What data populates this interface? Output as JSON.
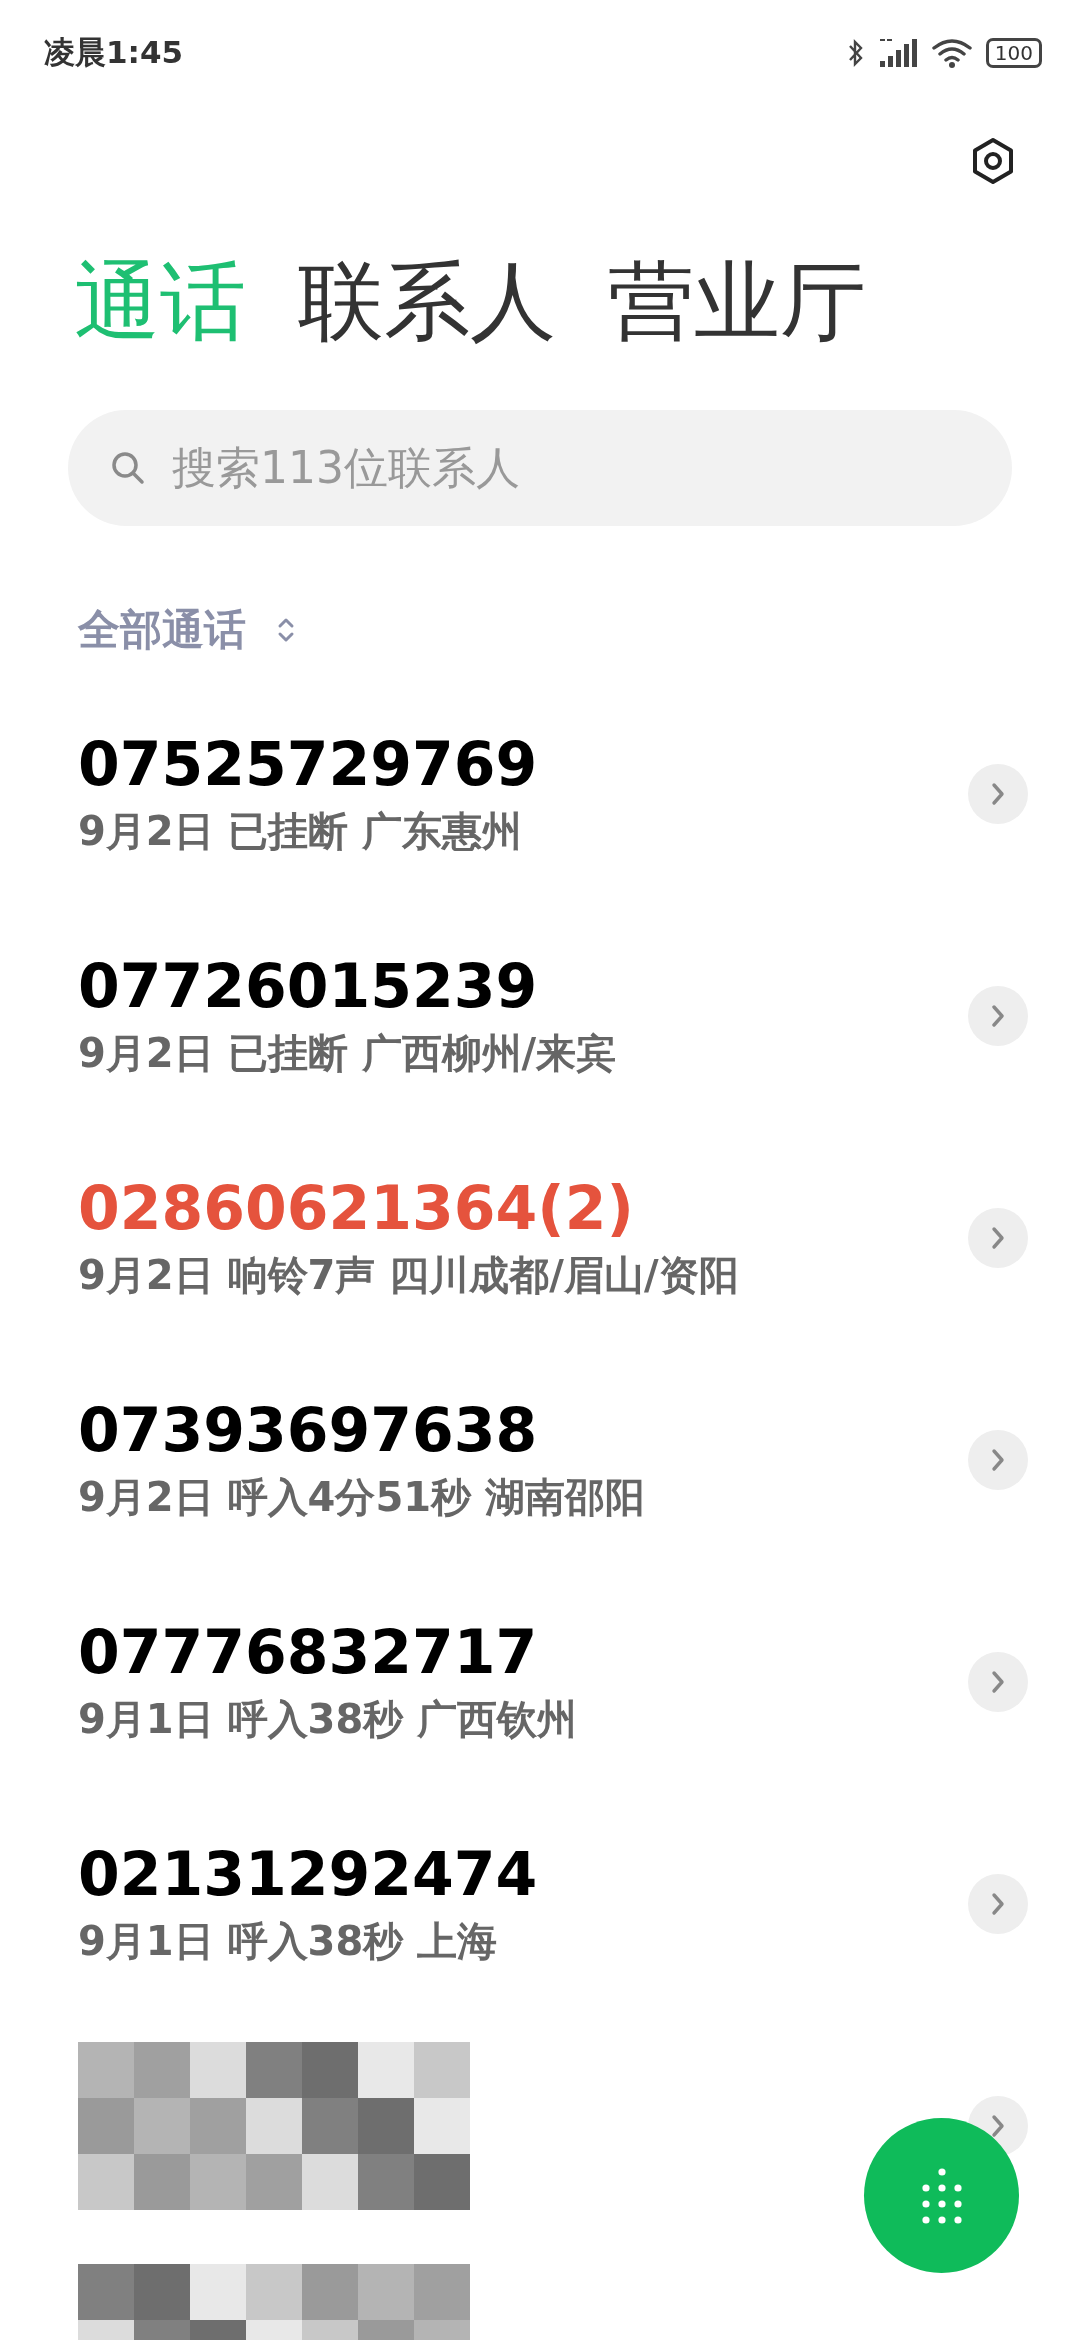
{
  "status_bar": {
    "time": "凌晨1:45",
    "battery": "100"
  },
  "tabs": [
    {
      "label": "通话",
      "selected": true
    },
    {
      "label": "联系人",
      "selected": false
    },
    {
      "label": "营业厅",
      "selected": false
    }
  ],
  "search": {
    "placeholder": "搜索113位联系人"
  },
  "filter": {
    "label": "全部通话"
  },
  "calls": [
    {
      "kind": "call",
      "number": "07525729769",
      "detail": "9月2日 已挂断 广东惠州",
      "missed": false
    },
    {
      "kind": "call",
      "number": "07726015239",
      "detail": "9月2日 已挂断 广西柳州/来宾",
      "missed": false
    },
    {
      "kind": "call",
      "number": "02860621364(2)",
      "detail": "9月2日 响铃7声 四川成都/眉山/资阳",
      "missed": true
    },
    {
      "kind": "call",
      "number": "07393697638",
      "detail": "9月2日 呼入4分51秒 湖南邵阳",
      "missed": false
    },
    {
      "kind": "call",
      "number": "07776832717",
      "detail": "9月1日 呼入38秒 广西钦州",
      "missed": false
    },
    {
      "kind": "call",
      "number": "02131292474",
      "detail": "9月1日 呼入38秒 上海",
      "missed": false
    },
    {
      "kind": "redacted"
    },
    {
      "kind": "redacted"
    }
  ]
}
